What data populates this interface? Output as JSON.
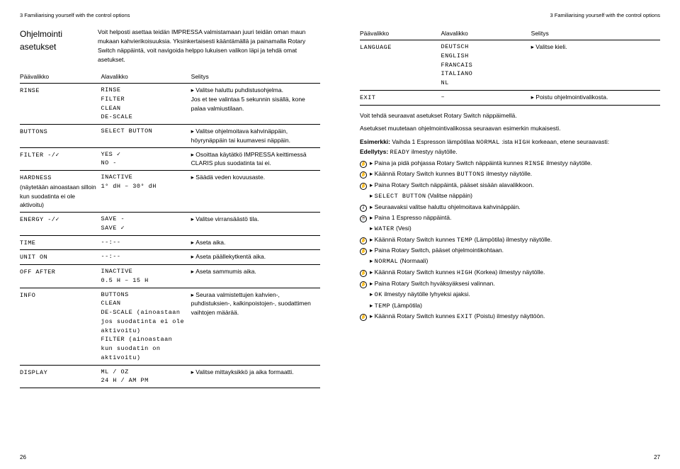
{
  "header": "3 Familiarising yourself with the control options",
  "sectionTitle": "Ohjelmointi asetukset",
  "intro": "Voit helposti asettaa teidän IMPRESSA valmistamaan juuri teidän oman maun mukaan kahvierikoisuuksia. Yksinkertaisesti kääntämällä ja painamalla Rotary Switch näppäintä, voit navigoida helppo lukuisen valikon läpi ja tehdä omat asetukset.",
  "tableHeaders": {
    "main": "Päävalikko",
    "sub": "Alavalikko",
    "desc": "Selitys"
  },
  "leftRows": [
    {
      "main": "RINSE",
      "sub": "RINSE\nFILTER\nCLEAN\nDE-SCALE",
      "desc": "Valitse haluttu puhdistusohjelma.\nJos et tee valintaa 5 sekunnin sisällä, kone palaa valmiustilaan."
    },
    {
      "main": "BUTTONS",
      "sub": "SELECT BUTTON",
      "desc": "Valitse ohjelmoitava kahvinäppäin, höyrynäppäin tai kuumavesi näppäin."
    },
    {
      "main": "FILTER -/✓",
      "sub": "YES ✓\nNO -",
      "desc": "Osoittaa käytätkö IMPRESSA keittimessä CLARIS plus suodatinta tai ei."
    },
    {
      "main": "HARDNESS",
      "mainExtra": "(näytetään ainoastaan silloin kun suodatinta ei ole aktivoitu)",
      "sub": "INACTIVE\n1° dH – 30° dH",
      "desc": "Säädä veden kovuusaste."
    },
    {
      "main": "ENERGY -/✓",
      "sub": "SAVE -\nSAVE ✓",
      "desc": "Valitse virransäästö tila."
    },
    {
      "main": "TIME",
      "sub": "--:--",
      "desc": "Aseta aika."
    },
    {
      "main": "UNIT ON",
      "sub": "--:--",
      "desc": "Aseta päällekytkentä aika."
    },
    {
      "main": "OFF AFTER",
      "sub": "INACTIVE\n0.5 H – 15 H",
      "desc": "Aseta sammumis aika."
    },
    {
      "main": "INFO",
      "sub": "BUTTONS\nCLEAN\nDE-SCALE",
      "subExtra": "(ainoastaan jos suodatinta ei ole aktivoitu)",
      "sub2": "FILTER",
      "subExtra2": "(ainoastaan kun suodatin on aktivoitu)",
      "desc": "Seuraa valmistettujen kahvien-, puhdistuksien-, kalkinpoistojen-, suodattimen vaihtojen määrää."
    },
    {
      "main": "DISPLAY",
      "sub": "ML / OZ\n24 H / AM PM",
      "desc": "Valitse mittayksikkö ja aika formaatti."
    }
  ],
  "rightRows": [
    {
      "main": "LANGUAGE",
      "sub": "DEUTSCH\nENGLISH\nFRANCAIS\nITALIANO\nNL",
      "desc": "Valitse kieli."
    },
    {
      "main": "EXIT",
      "sub": "–",
      "desc": "Poistu ohjelmointivalikosta."
    }
  ],
  "rightPara1": "Voit tehdä seuraavat asetukset Rotary Switch näppäimellä.",
  "rightPara2": "Asetukset muutetaan ohjelmointivalikossa seuraavan esimerkin mukaisesti.",
  "example": {
    "label": "Esimerkki:",
    "text1": "Vaihda 1 Espresson lämpötilaa ",
    "mono1": "NORMAL",
    "text2": " :ista ",
    "mono2": "HIGH",
    "text3": " korkeaan, etene seuraavasti:"
  },
  "precondLabel": "Edellytys:",
  "precondMono": "READY",
  "precondText": " ilmestyy näytölle.",
  "steps": [
    {
      "icon": "hand",
      "pre": "Paina ja pidä pohjassa Rotary Switch näppäintä kunnes ",
      "mono": "RINSE",
      "post": " ilmestyy näytölle."
    },
    {
      "icon": "hand",
      "pre": "Käännä Rotary Switch kunnes ",
      "mono": "BUTTONS",
      "post": " ilmestyy näytölle."
    },
    {
      "icon": "hand",
      "pre": "Paina Rotary Switch näppäintä, pääset sisään alavalikkoon.",
      "mono": "",
      "post": ""
    },
    {
      "icon": "",
      "pre": "",
      "mono": "SELECT BUTTON",
      "post": " (Valitse näppäin)"
    },
    {
      "icon": "i",
      "pre": "Seuraavaksi valitse haluttu ohjelmoitava kahvinäppäin.",
      "mono": "",
      "post": ""
    },
    {
      "icon": "cup",
      "pre": "Paina 1 Espresso näppäintä.",
      "mono": "",
      "post": ""
    },
    {
      "icon": "",
      "pre": "",
      "mono": "WATER",
      "post": " (Vesi)"
    },
    {
      "icon": "hand",
      "pre": "Käännä Rotary Switch kunnes ",
      "mono": "TEMP",
      "post": " (Lämpötila) ilmestyy näytölle."
    },
    {
      "icon": "hand",
      "pre": "Paina Rotary Switch, pääset ohjelmointikohtaan.",
      "mono": "",
      "post": ""
    },
    {
      "icon": "",
      "pre": "",
      "mono": "NORMAL",
      "post": " (Normaali)"
    },
    {
      "icon": "hand",
      "pre": "Käännä Rotary Switch kunnes ",
      "mono": "HIGH",
      "post": " (Korkea) ilmestyy näytölle."
    },
    {
      "icon": "hand",
      "pre": "Paina Rotary Switch hyväksyäksesi valinnan.",
      "mono": "",
      "post": ""
    },
    {
      "icon": "",
      "pre": "",
      "mono": "OK",
      "post": " ilmestyy näytölle lyhyeksi ajaksi."
    },
    {
      "icon": "",
      "pre": "",
      "mono": "TEMP",
      "post": " (Lämpötila)"
    },
    {
      "icon": "hand",
      "pre": "Käännä Rotary Switch kunnes ",
      "mono": "EXIT",
      "post": " (Poistu) ilmestyy näyttöön."
    }
  ],
  "pageNumLeft": "26",
  "pageNumRight": "27"
}
